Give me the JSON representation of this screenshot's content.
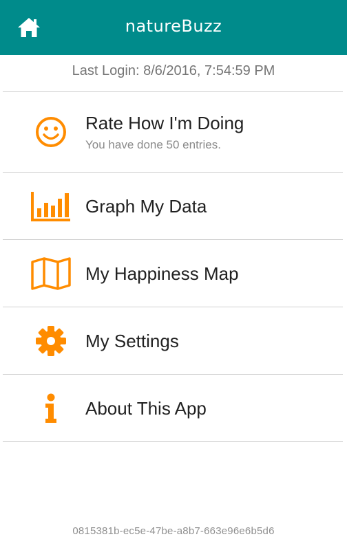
{
  "header": {
    "title": "natureBuzz",
    "home_icon": "home-icon"
  },
  "last_login": "Last Login: 8/6/2016, 7:54:59 PM",
  "menu": {
    "items": [
      {
        "label": "Rate How I'm Doing",
        "subtitle": "You have done 50 entries.",
        "icon": "smiley-icon"
      },
      {
        "label": "Graph My Data",
        "icon": "bar-chart-icon"
      },
      {
        "label": "My Happiness Map",
        "icon": "map-icon"
      },
      {
        "label": "My Settings",
        "icon": "gear-icon"
      },
      {
        "label": "About This App",
        "icon": "info-icon"
      }
    ]
  },
  "device_id": "0815381b-ec5e-47be-a8b7-663e96e6b5d6",
  "colors": {
    "header_bg": "#008b8b",
    "accent": "#ff8c00",
    "divider": "#d0d0d0"
  }
}
